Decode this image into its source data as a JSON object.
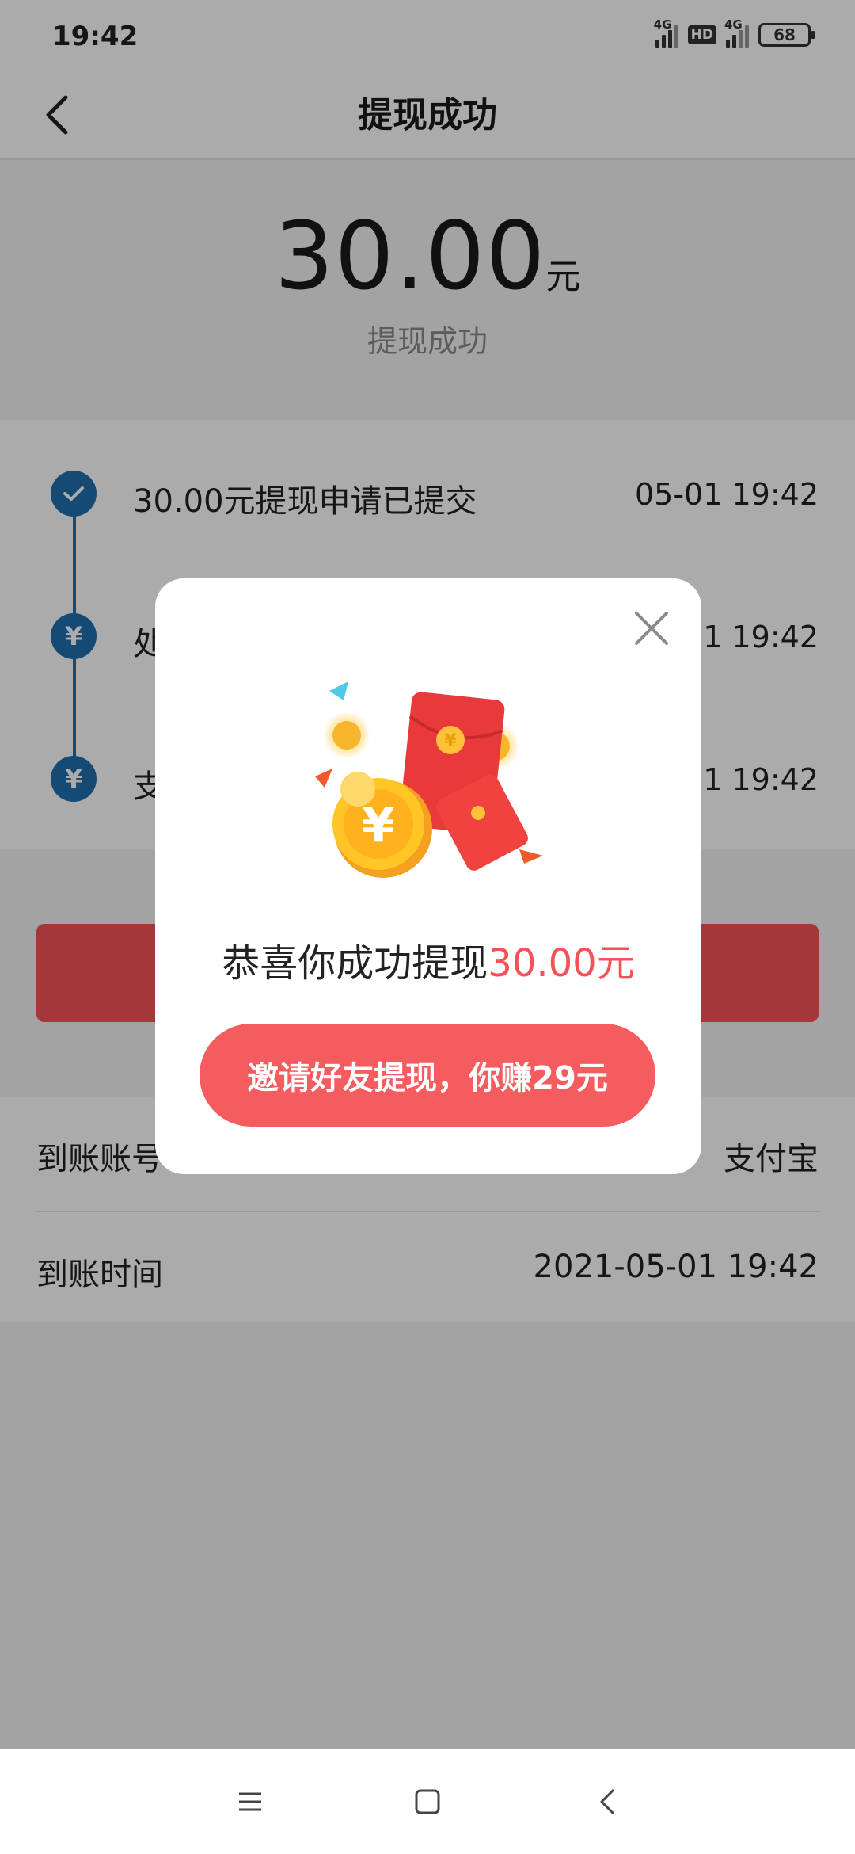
{
  "status_bar": {
    "time": "19:42",
    "signal1_label": "4G",
    "hd_label": "HD",
    "signal2_label": "4G",
    "battery": "68"
  },
  "nav": {
    "title": "提现成功",
    "back_icon": "chevron-left-icon"
  },
  "summary": {
    "amount": "30.00",
    "unit": "元",
    "status": "提现成功"
  },
  "timeline": [
    {
      "text": "30.00元提现申请已提交",
      "time": "05-01 19:42",
      "icon": "check"
    },
    {
      "text": "处",
      "time": "05-01 19:42",
      "icon": "yuan"
    },
    {
      "text": "支",
      "time": "05-01 19:42",
      "icon": "yuan"
    }
  ],
  "details": [
    {
      "label": "到账账号",
      "value": "支付宝"
    },
    {
      "label": "到账时间",
      "value": "2021-05-01 19:42"
    }
  ],
  "popup": {
    "congrats_text": "恭喜你成功提现",
    "congrats_amount": "30.00元",
    "invite_button": "邀请好友提现，你赚29元",
    "close_icon": "close-icon",
    "illustration_icon": "red-envelope-coins-icon"
  },
  "colors": {
    "accent": "#f45257",
    "timeline_blue": "#1e6fae"
  }
}
